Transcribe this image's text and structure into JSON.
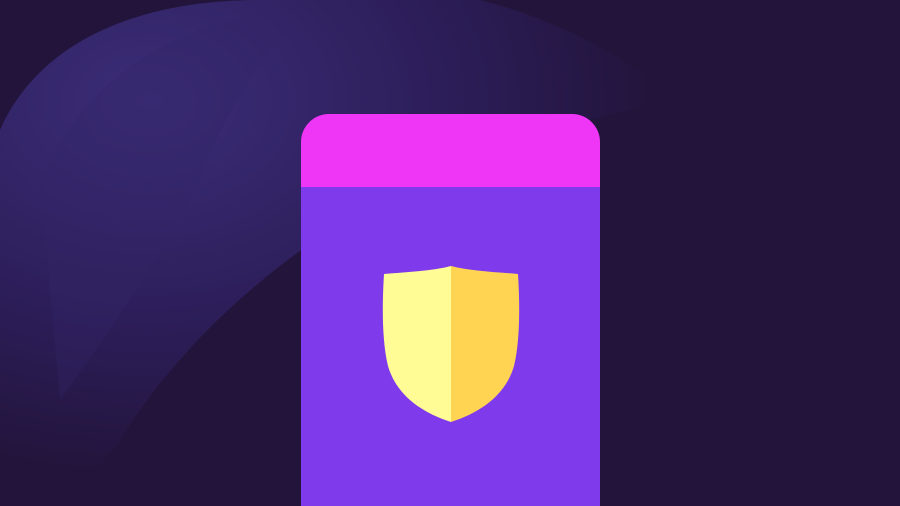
{
  "colors": {
    "background": "#22143a",
    "glow_inner": "#3b2d78",
    "glow_outer": "#2a1b52",
    "phone_header": "#ef36f7",
    "phone_body": "#7f3aec",
    "shield_light": "#fffb95",
    "shield_shade": "#ffd452"
  },
  "icons": {
    "shield": "shield-icon",
    "device": "phone-device"
  }
}
